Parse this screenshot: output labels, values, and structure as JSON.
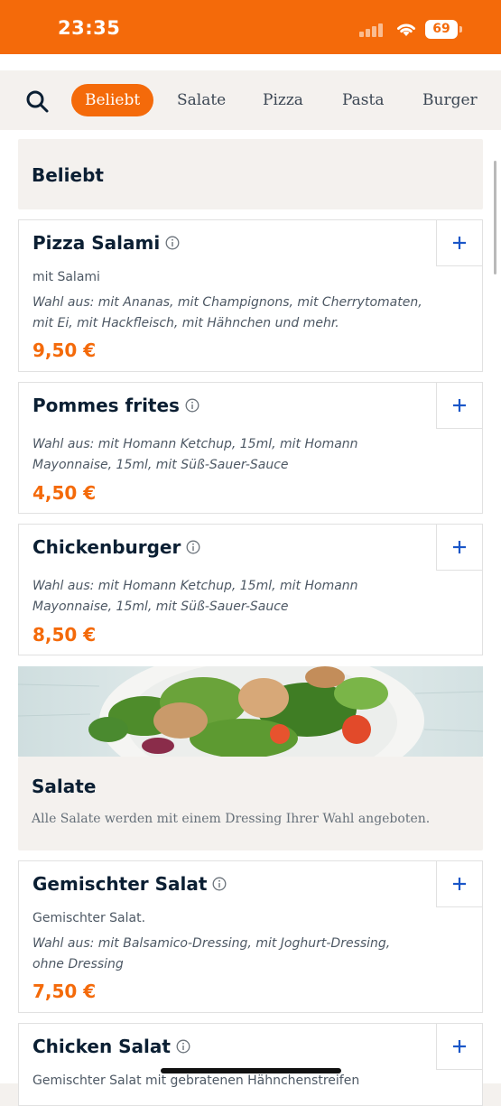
{
  "status_bar": {
    "time": "23:35",
    "battery": "69",
    "icons": [
      "cellular-signal-icon",
      "wifi-icon",
      "battery-icon"
    ]
  },
  "nav": {
    "search_icon": "search-icon",
    "categories": [
      "Beliebt",
      "Salate",
      "Pizza",
      "Pasta",
      "Burger"
    ],
    "active": "Beliebt"
  },
  "colors": {
    "accent": "#f46a0a",
    "section_bg": "#f4f1ee",
    "text_dark": "#0b1f33",
    "add_icon": "#1a56c8"
  },
  "sections": [
    {
      "title": "Beliebt",
      "items": [
        {
          "name": "Pizza Salami",
          "subtitle": "mit Salami",
          "options_line1": "Wahl aus: mit Ananas, mit Champignons, mit Cherrytomaten,",
          "options_line2": "mit Ei, mit Hackfleisch, mit Hähnchen und mehr.",
          "price": "9,50 €"
        },
        {
          "name": "Pommes frites",
          "options_line1": "Wahl aus: mit Homann Ketchup, 15ml, mit Homann",
          "options_line2": "Mayonnaise, 15ml, mit Süß-Sauer-Sauce",
          "price": "4,50 €"
        },
        {
          "name": "Chickenburger",
          "options_line1": "Wahl aus: mit Homann Ketchup, 15ml, mit Homann",
          "options_line2": "Mayonnaise, 15ml, mit Süß-Sauer-Sauce",
          "price": "8,50 €"
        }
      ]
    },
    {
      "title": "Salate",
      "description": "Alle Salate werden mit einem Dressing Ihrer Wahl angeboten.",
      "items": [
        {
          "name": "Gemischter Salat",
          "subtitle": "Gemischter Salat.",
          "options_line1": "Wahl aus: mit Balsamico-Dressing, mit Joghurt-Dressing,",
          "options_line2": "ohne Dressing",
          "price": "7,50 €"
        },
        {
          "name": "Chicken Salat",
          "subtitle": "Gemischter Salat mit gebratenen Hähnchenstreifen"
        }
      ]
    }
  ]
}
